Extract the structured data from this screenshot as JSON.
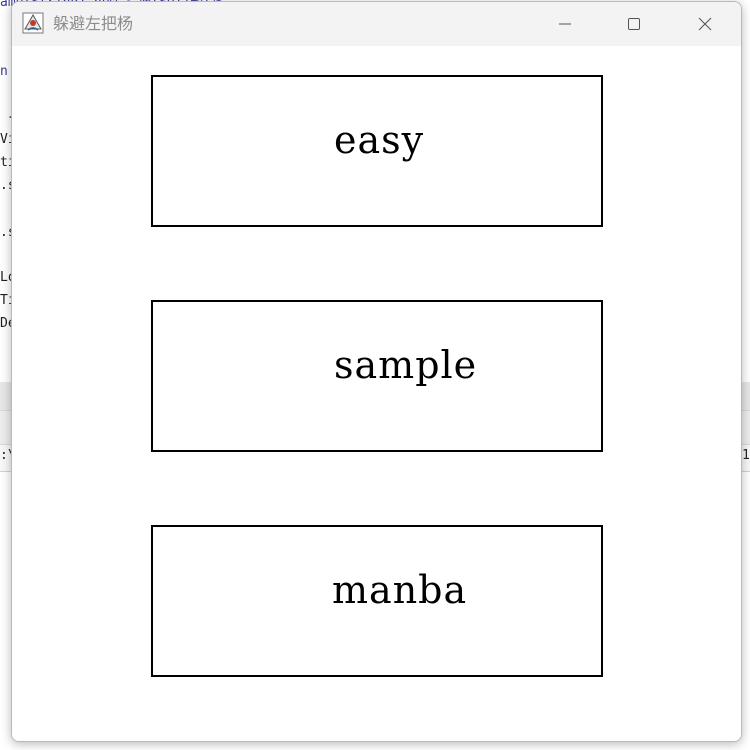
{
  "window": {
    "title": "躲避左把杨"
  },
  "options": [
    {
      "label": "easy"
    },
    {
      "label": "sample"
    },
    {
      "label": "manba"
    }
  ],
  "icons": {
    "app": "java-app-icon",
    "minimize": "minimize-icon",
    "maximize": "maximize-icon",
    "close": "close-icon"
  },
  "colors": {
    "titlebar": "#f3f3f3",
    "title_text": "#8c8c8c",
    "box_border": "#000000"
  }
}
